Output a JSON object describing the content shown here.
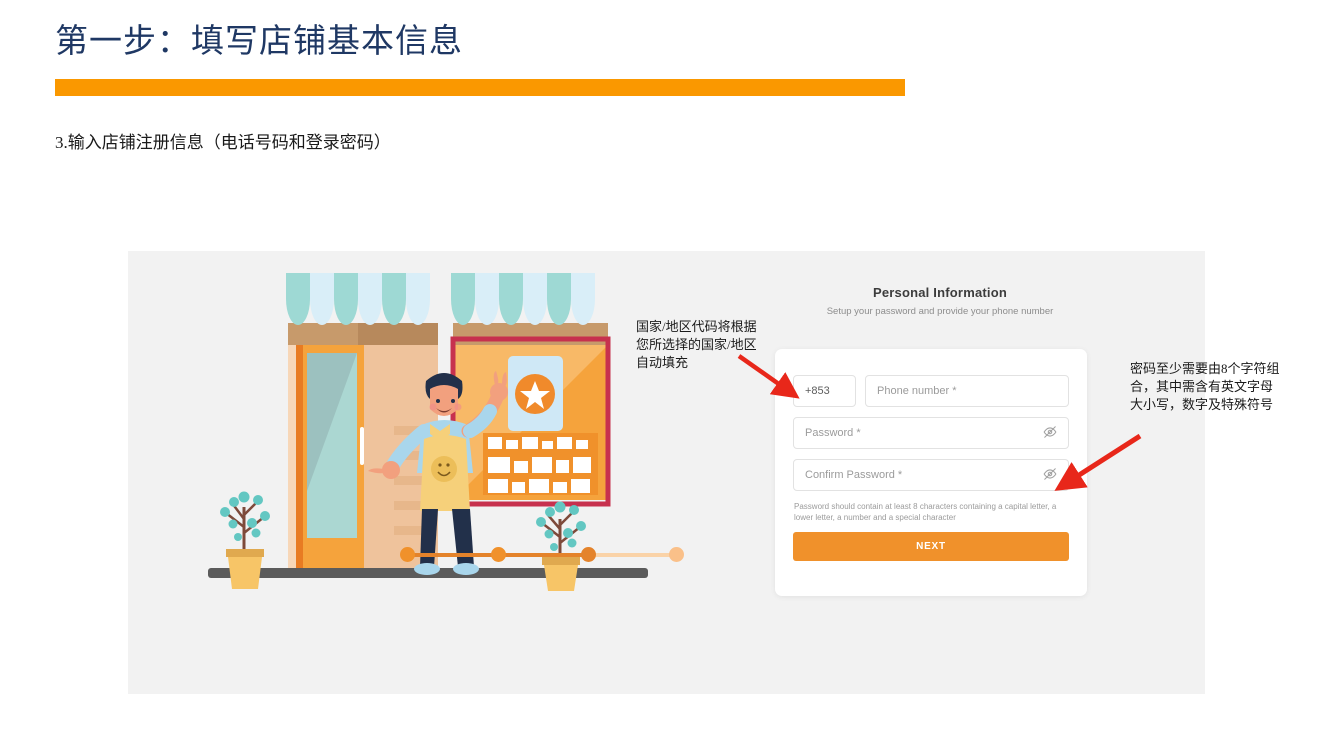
{
  "slide": {
    "title": "第一步：填写店铺基本信息",
    "instruction": "3.输入店铺注册信息（电话号码和登录密码）",
    "accent_color": "#FA9800",
    "title_color": "#1F3864"
  },
  "annotations": [
    {
      "name": "country-code-note",
      "text": "国家/地区代码将根据\n您所选择的国家/地区\n自动填充",
      "arrow_color": "#E8271A"
    },
    {
      "name": "password-rule-note",
      "text": "密码至少需要由8个字符组\n合，其中需含有英文字母\n大小写，数字及特殊符号",
      "arrow_color": "#E8271A"
    }
  ],
  "screenshot": {
    "background": "#f2f2f2",
    "illustration": {
      "name": "shop-owner-storefront",
      "awning_colors": [
        "#9ED9D4",
        "#D9EEF8"
      ],
      "ground_color": "#5B5B5B",
      "door_color": "#F5A33C",
      "apron_color": "#F6D07A",
      "plant_pot_color": "#F7C567"
    },
    "progress": {
      "name": "onboarding-steps",
      "total": 4,
      "completed": 3,
      "active_color": "#F0912B",
      "inactive_color": "#FAD3A8"
    },
    "form": {
      "heading": "Personal Information",
      "subheading": "Setup your password and provide your phone number",
      "country_code": "+853",
      "fields": [
        {
          "name": "phone-number-input",
          "placeholder": "Phone number *",
          "value": "",
          "has_eye_toggle": false
        },
        {
          "name": "password-input",
          "placeholder": "Password *",
          "value": "",
          "has_eye_toggle": true
        },
        {
          "name": "confirm-password-input",
          "placeholder": "Confirm Password *",
          "value": "",
          "has_eye_toggle": true
        }
      ],
      "password_hint": "Password should contain at least 8 characters containing a capital letter, a lower letter, a number and a special character",
      "submit_label": "NEXT",
      "submit_color": "#F0912B"
    }
  }
}
